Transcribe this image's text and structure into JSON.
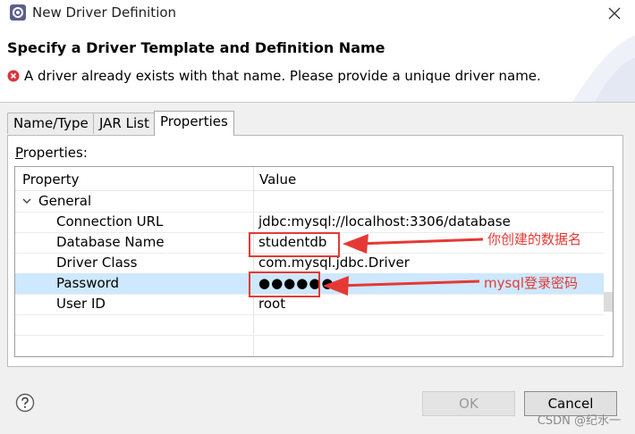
{
  "window": {
    "title": "New Driver Definition",
    "close_symbol": "✕"
  },
  "header": {
    "heading": "Specify a Driver Template and Definition Name",
    "error_message": "A driver already exists with that name. Please provide a unique driver name."
  },
  "tabs": [
    {
      "label": "Name/Type",
      "active": false
    },
    {
      "label": "JAR List",
      "active": false
    },
    {
      "label": "Properties",
      "active": true
    }
  ],
  "properties": {
    "label_first": "P",
    "label_rest": "roperties:",
    "columns": [
      "Property",
      "Value"
    ],
    "group": "General",
    "rows": [
      {
        "property": "Connection URL",
        "value": "jdbc:mysql://localhost:3306/database"
      },
      {
        "property": "Database Name",
        "value": "studentdb"
      },
      {
        "property": "Driver Class",
        "value": "com.mysql.jdbc.Driver"
      },
      {
        "property": "Password",
        "value": "●●●●●●"
      },
      {
        "property": "User ID",
        "value": "root"
      }
    ]
  },
  "annotations": {
    "database_note": "你创建的数据名",
    "password_note": "mysql登录密码",
    "color": "#e53935"
  },
  "buttons": {
    "ok": "OK",
    "cancel": "Cancel"
  },
  "watermark": "CSDN @纪水一",
  "icons": [
    "app-gear-icon",
    "close-icon",
    "error-icon",
    "chevron-down-icon",
    "help-icon"
  ]
}
